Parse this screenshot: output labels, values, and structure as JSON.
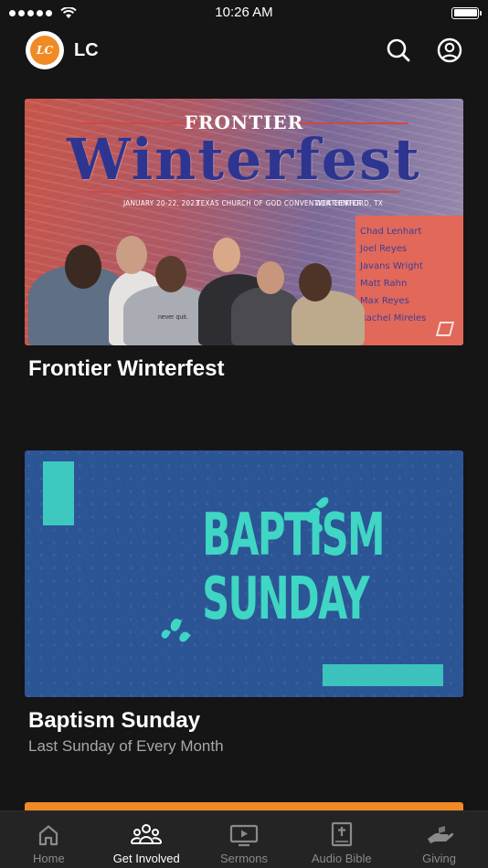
{
  "status": {
    "time": "10:26 AM"
  },
  "app": {
    "logo_text": "LC",
    "title": "LC"
  },
  "cards": [
    {
      "title": "Frontier Winterfest",
      "subtitle": "",
      "banner": {
        "kicker": "FRONTIER",
        "headline": "Winterfest",
        "date": "JANUARY 20-22, 2023",
        "venue": "TEXAS CHURCH OF GOD CONVENTION CENTER",
        "city": "WEATHERFORD, TX",
        "speakers": [
          "Chad Lenhart",
          "Joel Reyes",
          "Javans Wright",
          "Matt Rahn",
          "Max Reyes",
          "Rachel Mireles"
        ],
        "shirt_text": "never quit."
      }
    },
    {
      "title": "Baptism Sunday",
      "subtitle": "Last Sunday of Every Month",
      "banner": {
        "line1": "BAPTISM",
        "line2": "SUNDAY"
      }
    }
  ],
  "tabs": [
    {
      "label": "Home",
      "icon": "home-icon",
      "active": false
    },
    {
      "label": "Get Involved",
      "icon": "people-icon",
      "active": true
    },
    {
      "label": "Sermons",
      "icon": "play-screen-icon",
      "active": false
    },
    {
      "label": "Audio Bible",
      "icon": "bible-icon",
      "active": false
    },
    {
      "label": "Giving",
      "icon": "giving-hand-icon",
      "active": false
    }
  ],
  "colors": {
    "accent": "#f08a24",
    "background": "#151515",
    "tab_bar": "#242424",
    "teal": "#3fd6c4",
    "baptism_blue": "#2c5596"
  }
}
